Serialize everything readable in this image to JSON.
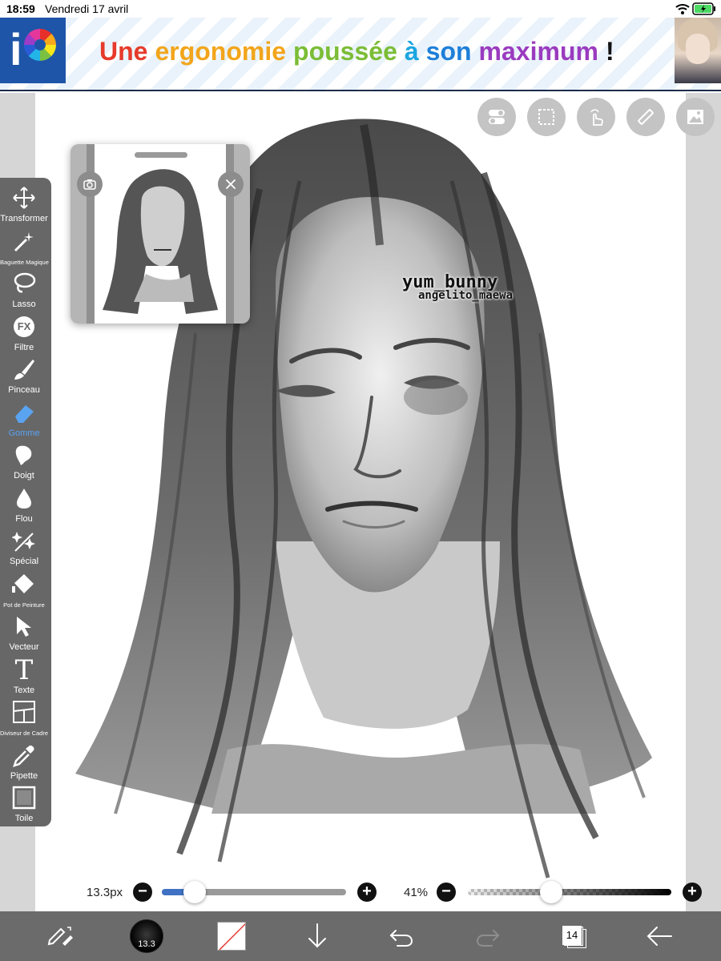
{
  "status_bar": {
    "time": "18:59",
    "date": "Vendredi 17 avril"
  },
  "banner": {
    "slogan_words": [
      {
        "text": "Une",
        "color": "#e63a2a"
      },
      {
        "text": "ergonomie",
        "color": "#f2a51b"
      },
      {
        "text": "poussée",
        "color": "#7bbd36"
      },
      {
        "text": "à",
        "color": "#1ba6e0"
      },
      {
        "text": "son",
        "color": "#1e7fd8"
      },
      {
        "text": "maximum",
        "color": "#9a3bbf"
      },
      {
        "text": "!",
        "color": "#111111"
      }
    ],
    "logo_letter": "i"
  },
  "watermark": {
    "line1": "yum_bunny",
    "line2": "angelito_maewa"
  },
  "toolbar": {
    "items": [
      {
        "name": "transform",
        "label": "Transformer",
        "small": false,
        "active": false
      },
      {
        "name": "magic-wand",
        "label": "Baguette Magique",
        "small": true,
        "active": false
      },
      {
        "name": "lasso",
        "label": "Lasso",
        "small": false,
        "active": false
      },
      {
        "name": "filter",
        "label": "Filtre",
        "small": false,
        "active": false,
        "icon_text": "FX"
      },
      {
        "name": "brush",
        "label": "Pinceau",
        "small": false,
        "active": false
      },
      {
        "name": "eraser",
        "label": "Gomme",
        "small": false,
        "active": true
      },
      {
        "name": "smudge",
        "label": "Doigt",
        "small": false,
        "active": false
      },
      {
        "name": "blur",
        "label": "Flou",
        "small": false,
        "active": false
      },
      {
        "name": "special",
        "label": "Spécial",
        "small": false,
        "active": false
      },
      {
        "name": "bucket",
        "label": "Pot de Peinture",
        "small": true,
        "active": false
      },
      {
        "name": "vector",
        "label": "Vecteur",
        "small": false,
        "active": false
      },
      {
        "name": "text",
        "label": "Texte",
        "small": false,
        "active": false,
        "icon_text": "T"
      },
      {
        "name": "frame-divider",
        "label": "Diviseur de Cadre",
        "small": true,
        "active": false
      },
      {
        "name": "eyedropper",
        "label": "Pipette",
        "small": false,
        "active": false
      },
      {
        "name": "canvas",
        "label": "Toile",
        "small": false,
        "active": false
      }
    ]
  },
  "sliders": {
    "size_label": "13.3px",
    "size_fraction": 0.18,
    "opacity_label": "41%",
    "opacity_fraction": 0.41,
    "minus": "−",
    "plus": "+"
  },
  "bottom_bar": {
    "brush_size": "13.3",
    "layer_count": "14"
  },
  "icons": {
    "top_buttons": [
      "toggle-icon",
      "selection-icon",
      "gesture-icon",
      "ruler-icon",
      "reference-icon"
    ],
    "bottom": [
      "edit-mode-icon",
      "brush-size-icon",
      "color-icon",
      "download-icon",
      "undo-icon",
      "redo-icon",
      "layers-icon",
      "back-icon"
    ]
  },
  "colors": {
    "toolbar_bg": "#676767",
    "active_accent": "#5aa3f0",
    "size_track": "#3f72c4"
  }
}
